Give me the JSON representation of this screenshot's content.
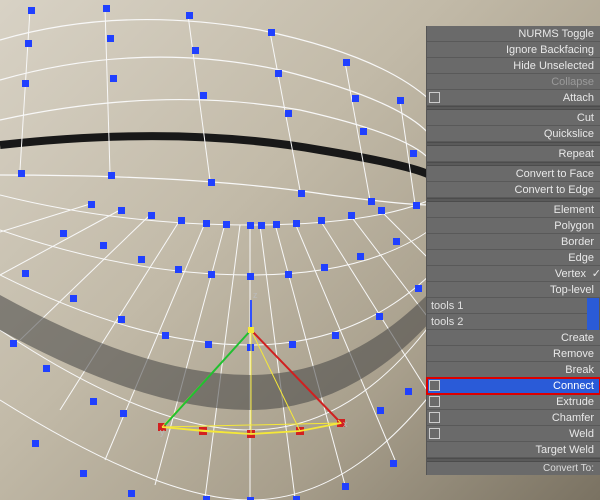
{
  "menu": {
    "nurms_toggle": "NURMS Toggle",
    "ignore_backfacing": "Ignore Backfacing",
    "hide_unselected": "Hide Unselected",
    "collapse": "Collapse",
    "attach": "Attach",
    "cut": "Cut",
    "quickslice": "Quickslice",
    "repeat": "Repeat",
    "convert_to_face": "Convert to Face",
    "convert_to_edge": "Convert to Edge",
    "element": "Element",
    "polygon": "Polygon",
    "border": "Border",
    "edge": "Edge",
    "vertex": "Vertex",
    "top_level": "Top-level",
    "tools1": "tools 1",
    "tools2": "tools 2",
    "create": "Create",
    "remove": "Remove",
    "break": "Break",
    "connect": "Connect",
    "extrude": "Extrude",
    "chamfer": "Chamfer",
    "weld": "Weld",
    "target_weld": "Target Weld",
    "convert_to": "Convert To:"
  }
}
